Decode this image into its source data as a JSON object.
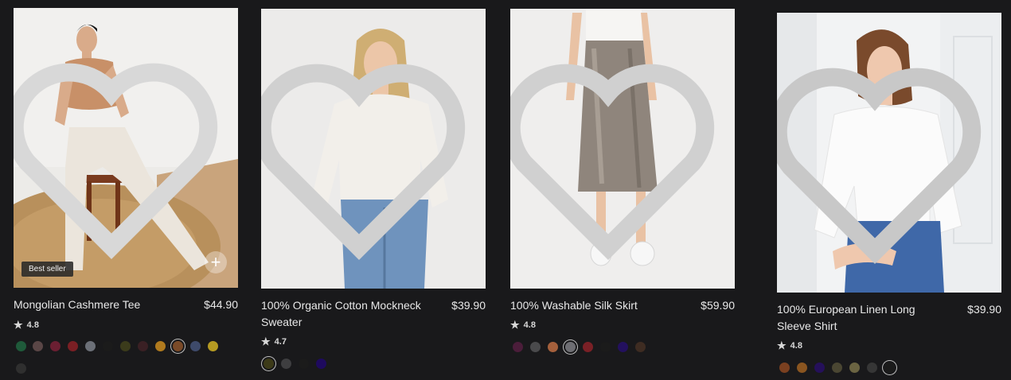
{
  "products": [
    {
      "name": "Mongolian Cashmere Tee",
      "price": "$44.90",
      "rating": "4.8",
      "badge": "Best seller",
      "image_icon": "heart-icon",
      "swatches": [
        "#1f5a3a",
        "#5a4646",
        "#6b1f32",
        "#7a1f24",
        "#6c7078",
        "#1b1b1b",
        "#3b3b1b",
        "#3a2024",
        "#b07a1e",
        "#7a4a28",
        "#3e4a6a",
        "#b59a22",
        "#2f2f2f"
      ]
    },
    {
      "name": "100% Organic Cotton Mockneck Sweater",
      "price": "$39.90",
      "rating": "4.7",
      "swatches": [
        "#3c3a18",
        "#3e3e40",
        "#1b1b1b",
        "#1e0a5e"
      ]
    },
    {
      "name": "100% Washable Silk Skirt",
      "price": "$59.90",
      "rating": "4.8",
      "swatches": [
        "#4b1d3a",
        "#4a4a4c",
        "#a5603c",
        "#6e6e73",
        "#7a2026",
        "#1b1b1b",
        "#23105e",
        "#3e2c22"
      ]
    },
    {
      "name": "100% European Linen Long Sleeve Shirt",
      "price": "$39.90",
      "rating": "4.8",
      "swatches": [
        "#7a4020",
        "#8a5520",
        "#25105a",
        "#4a4632",
        "#6b6442",
        "#363636",
        "#1b1b1b"
      ]
    }
  ]
}
